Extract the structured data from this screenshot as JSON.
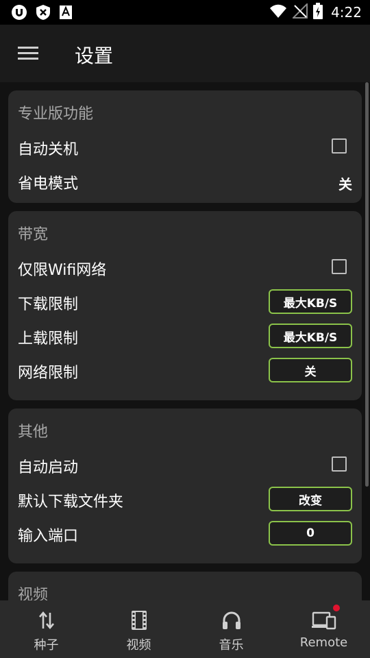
{
  "status_bar": {
    "time": "4:22"
  },
  "app_bar": {
    "title": "设置"
  },
  "sections": {
    "pro": {
      "title": "专业版功能",
      "auto_shutdown": "自动关机",
      "power_save": "省电模式",
      "power_save_value": "关"
    },
    "bandwidth": {
      "title": "带宽",
      "wifi_only": "仅限Wifi网络",
      "download_limit": "下载限制",
      "download_limit_value": "最大KB/S",
      "upload_limit": "上载限制",
      "upload_limit_value": "最大KB/S",
      "network_limit": "网络限制",
      "network_limit_value": "关"
    },
    "other": {
      "title": "其他",
      "auto_start": "自动启动",
      "default_folder": "默认下载文件夹",
      "default_folder_value": "改变",
      "incoming_port": "输入端口",
      "incoming_port_value": "0"
    },
    "video": {
      "title": "视频"
    }
  },
  "bottom_nav": {
    "torrents": "种子",
    "video": "视频",
    "music": "音乐",
    "remote": "Remote"
  },
  "colors": {
    "accent": "#8bc34a",
    "badge": "#e0132f"
  }
}
